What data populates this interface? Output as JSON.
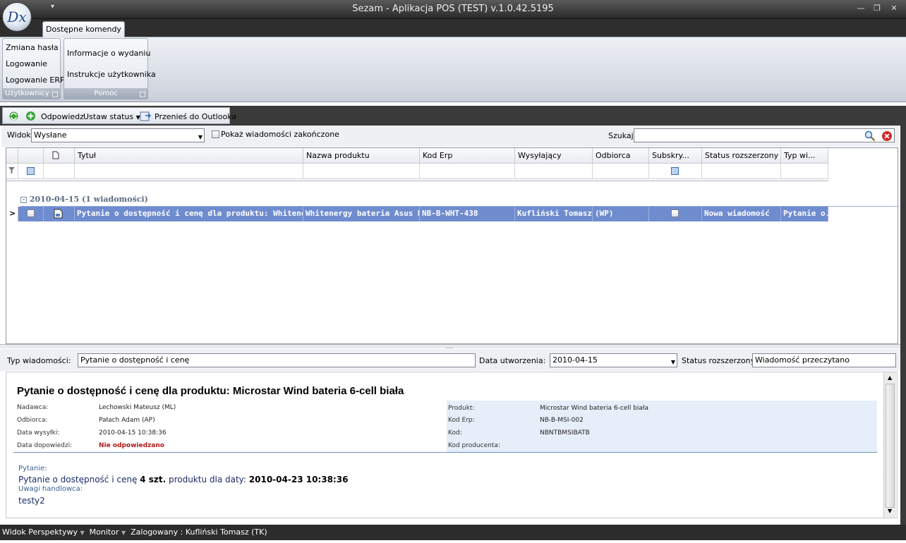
{
  "app": {
    "title": "Sezam - Aplikacja POS (TEST) v.1.0.42.5195",
    "logo": "Dx",
    "qat_icon": "dropdown-arrow-icon"
  },
  "window": {
    "minimize": "—",
    "restore": "❐",
    "close": "✕"
  },
  "ribbon": {
    "tab": "Dostępne komendy",
    "groups": [
      {
        "label": "Użytkownicy",
        "items": [
          "Zmiana hasła",
          "Logowanie",
          "Logowanie ERP"
        ]
      },
      {
        "label": "Pomoc",
        "items": [
          "Informacje o wydaniu",
          "Instrukcje użytkownika"
        ]
      }
    ]
  },
  "toolbar": {
    "refresh_icon": "refresh-icon",
    "add_icon": "add-icon",
    "reply": "Odpowiedz",
    "set_status": "Ustaw status",
    "move_outlook": "Przenieś do Outlooka"
  },
  "filter": {
    "view_label": "Widok",
    "view_value": "Wysłane",
    "show_finished": "Pokaż wiadomości zakończone",
    "search_label": "Szukaj",
    "search_value": ""
  },
  "grid": {
    "columns": [
      "Tytuł",
      "Nazwa produktu",
      "Kod Erp",
      "Wysyłający",
      "Odbiorca",
      "Subskry...",
      "Status rozszerzony",
      "Typ wi..."
    ],
    "group_label": "2010-04-15 (1 wiadomości)",
    "rows": [
      {
        "title": "Pytanie o dostępność i cenę dla produktu: Whitenergy ...",
        "product": "Whitenergy bateria Asus N...",
        "erp": "NB-B-WHT-438",
        "sender": "Kufliński Tomasz...",
        "recipient": "(WP)",
        "status": "Nowa wiadomość",
        "type": "Pytanie o..."
      }
    ]
  },
  "detail": {
    "type_label": "Typ wiadomości:",
    "type_value": "Pytanie o dostępność i cenę",
    "date_label": "Data utworzenia:",
    "date_value": "2010-04-15",
    "status_label": "Status rozszerzony:",
    "status_value": "Wiadomość przeczytano"
  },
  "preview": {
    "heading": "Pytanie o dostępność i cenę dla produktu: Microstar Wind bateria 6-cell biała",
    "left": [
      {
        "label": "Nadawca:",
        "value": "Lechowski Mateusz (ML)"
      },
      {
        "label": "Odbiorca:",
        "value": "Pałach Adam (AP)"
      },
      {
        "label": "Data wysyłki:",
        "value": "2010-04-15 10:38:36"
      },
      {
        "label": "Data dopowiedzi:",
        "value": "Nie odpowiedzano"
      }
    ],
    "right": [
      {
        "label": "Produkt:",
        "value": "Microstar Wind bateria 6-cell biała"
      },
      {
        "label": "Kod Erp:",
        "value": "NB-B-MSI-002"
      },
      {
        "label": "Kod:",
        "value": "NBNTBMSIBATB"
      },
      {
        "label": "Kod producenta:",
        "value": ""
      }
    ],
    "question_label": "Pytanie:",
    "question_a": "Pytanie o dostępność i cenę",
    "question_qty": "4 szt.",
    "question_b": "produktu dla daty:",
    "question_date": "2010-04-23 10:38:36",
    "remarks_label": "Uwagi handlowca:",
    "remarks_value": "testy2"
  },
  "status": {
    "view": "Widok",
    "perspectives": "Perspektywy",
    "monitor": "Monitor",
    "logged": "Zalogowany : Kufliński Tomasz (TK)"
  }
}
